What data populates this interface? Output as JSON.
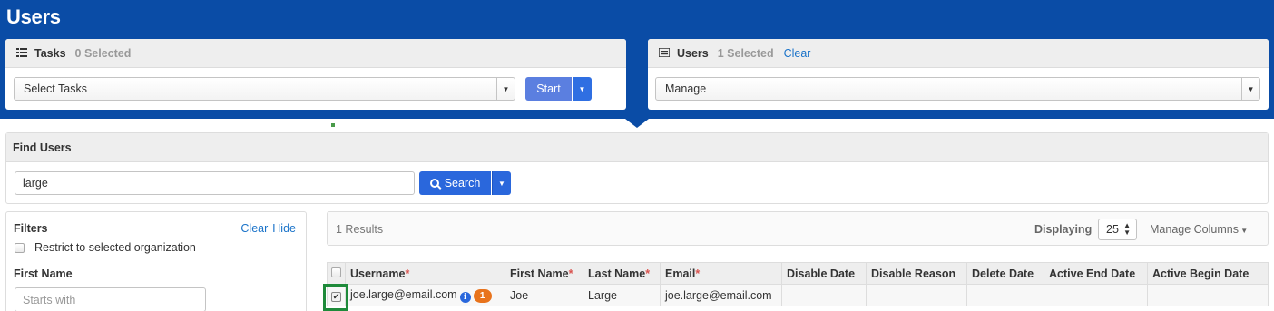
{
  "page": {
    "title": "Users"
  },
  "tasks_panel": {
    "icon": "tasks-list-icon",
    "title": "Tasks",
    "selected": "0 Selected",
    "select_value": "Select Tasks",
    "start_label": "Start"
  },
  "users_panel": {
    "icon": "users-list-icon",
    "title": "Users",
    "selected": "1 Selected",
    "clear_label": "Clear",
    "select_value": "Manage"
  },
  "find_users": {
    "title": "Find Users",
    "query": "large",
    "search_label": "Search"
  },
  "filters": {
    "title": "Filters",
    "clear_label": "Clear",
    "hide_label": "Hide",
    "restrict_label": "Restrict to selected organization",
    "restrict_checked": false,
    "first_name_label": "First Name",
    "first_name_placeholder": "Starts with"
  },
  "results": {
    "count_text": "1 Results",
    "displaying_label": "Displaying",
    "page_size": "25",
    "manage_columns_label": "Manage Columns"
  },
  "table": {
    "columns": [
      {
        "label": "Username",
        "required": "*"
      },
      {
        "label": "First Name",
        "required": "*"
      },
      {
        "label": "Last Name",
        "required": "*"
      },
      {
        "label": "Email",
        "required": "*"
      },
      {
        "label": "Disable Date"
      },
      {
        "label": "Disable Reason"
      },
      {
        "label": "Delete Date"
      },
      {
        "label": "Active End Date"
      },
      {
        "label": "Active Begin Date"
      }
    ],
    "rows": [
      {
        "checked": true,
        "username": "joe.large@email.com",
        "badge": "1",
        "first_name": "Joe",
        "last_name": "Large",
        "email": "joe.large@email.com",
        "disable_date": "",
        "disable_reason": "",
        "delete_date": "",
        "active_end_date": "",
        "active_begin_date": ""
      }
    ]
  },
  "colors": {
    "header_bar": "#0a4ca6",
    "primary_button": "#2a67dc",
    "start_button": "#5b7fe0",
    "required_star": "#d9534f",
    "badge": "#e8731c",
    "selection_highlight": "#1e8a3a",
    "link": "#1a73c9"
  }
}
